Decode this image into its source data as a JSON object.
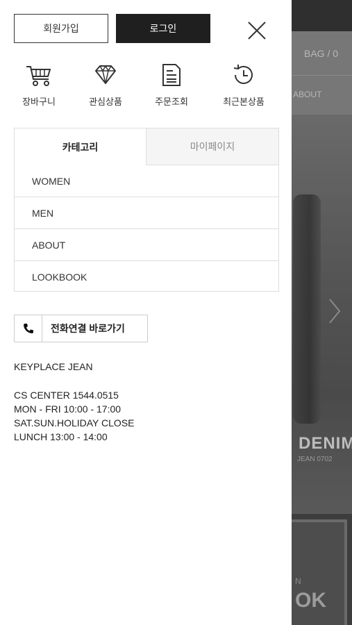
{
  "background": {
    "bag_label": "BAG / 0",
    "about_label": "ABOUT",
    "hero_title": "DENIM",
    "hero_subtitle": "JEAN 0702",
    "bottom_letter": "N",
    "bottom_title": "OK"
  },
  "header": {
    "join_label": "회원가입",
    "login_label": "로그인"
  },
  "shortcuts": [
    {
      "label": "장바구니",
      "icon": "cart-icon"
    },
    {
      "label": "관심상품",
      "icon": "diamond-icon"
    },
    {
      "label": "주문조회",
      "icon": "document-icon"
    },
    {
      "label": "최근본상품",
      "icon": "history-icon"
    }
  ],
  "tabs": {
    "category": "카테고리",
    "mypage": "마이페이지"
  },
  "menu": [
    "WOMEN",
    "MEN",
    "ABOUT",
    "LOOKBOOK"
  ],
  "call_button": "전화연결 바로가기",
  "company": "KEYPLACE JEAN",
  "cs": {
    "center": "CS CENTER 1544.0515",
    "weekdays": "MON - FRI 10:00 - 17:00",
    "closed": "SAT.SUN.HOLIDAY CLOSE",
    "lunch": "LUNCH 13:00 - 14:00"
  }
}
